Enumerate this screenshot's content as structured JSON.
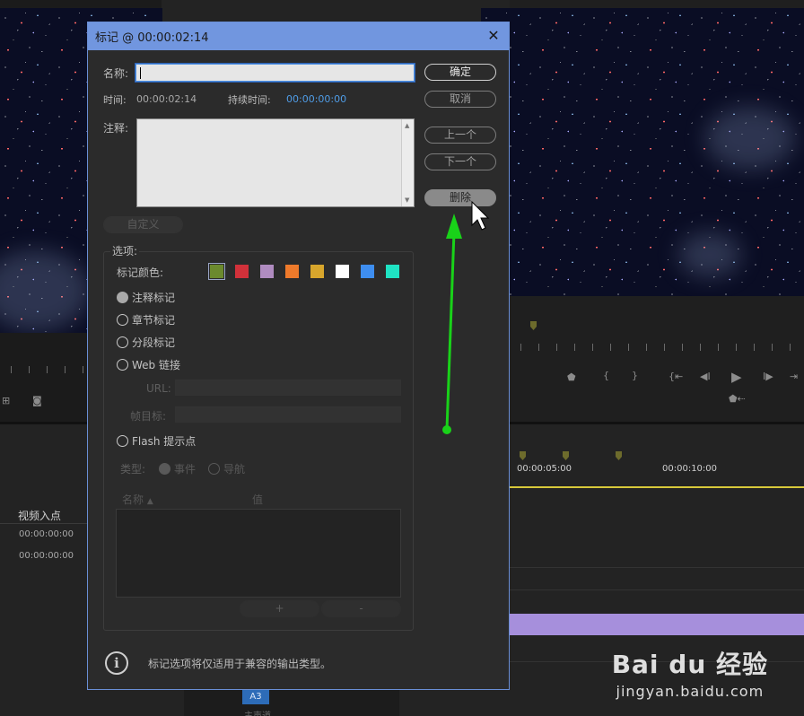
{
  "dialog": {
    "title": "标记 @ 00:00:02:14",
    "name_label": "名称:",
    "name_value": "",
    "time_label": "时间:",
    "time_value": "00:00:02:14",
    "duration_label": "持续时间:",
    "duration_value": "00:00:00:00",
    "comment_label": "注释:",
    "comment_value": "",
    "buttons": {
      "ok": "确定",
      "cancel": "取消",
      "previous": "上一个",
      "next": "下一个",
      "delete": "删除",
      "custom": "自定义"
    },
    "options_label": "选项:",
    "marker_color_label": "标记颜色:",
    "marker_colors": [
      "#6b8a2e",
      "#d1313a",
      "#b08cc0",
      "#ee7a2b",
      "#d8a62c",
      "#ffffff",
      "#3e8ef0",
      "#1fe3c3"
    ],
    "selected_color_index": 0,
    "marker_types": {
      "comment": "注释标记",
      "chapter": "章节标记",
      "segmentation": "分段标记",
      "web_link": "Web 链接",
      "flash": "Flash 提示点"
    },
    "selected_marker_type": "comment",
    "url_label": "URL:",
    "frame_target_label": "帧目标:",
    "type_label": "类型:",
    "event_label": "事件",
    "navigation_label": "导航",
    "table_headers": {
      "name": "名称",
      "value": "值"
    },
    "add_button": "+",
    "remove_button": "-",
    "info_text": "标记选项将仅适用于兼容的输出类型。"
  },
  "background": {
    "timeline_tc_1": "00:00:05:00",
    "timeline_tc_2": "00:00:10:00",
    "video_in_header": "视频入点",
    "row_1_time": "00:00:00:00",
    "row_2_time": "00:00:00:00",
    "track_label": "A3",
    "track_name": "主声道"
  },
  "watermark": {
    "logo": "Bai du 经验",
    "url": "jingyan.baidu.com"
  },
  "colors": {
    "titlebar": "#7196df",
    "accent_blue": "#4f9ce6",
    "annotation_arrow": "#19d219",
    "timeline_playhead": "#d7c83a",
    "clip_purple": "#a68fdc"
  }
}
